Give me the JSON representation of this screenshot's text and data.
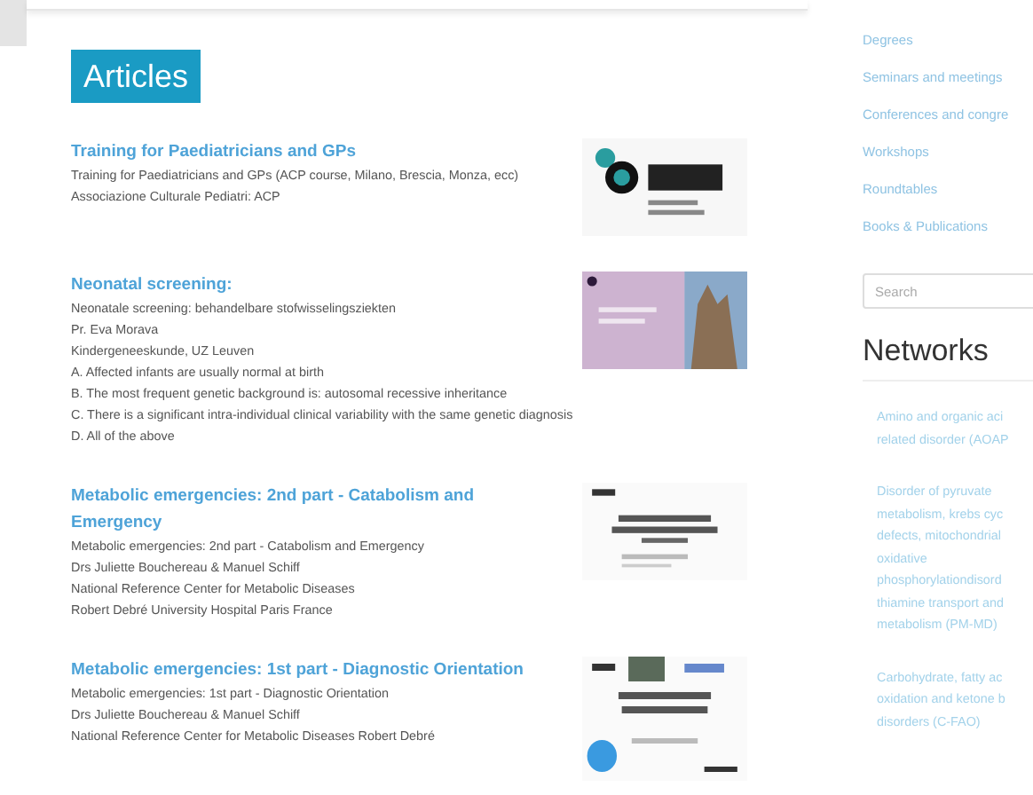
{
  "header": {
    "title": "Articles"
  },
  "articles": [
    {
      "title": "Training for Paediatricians and GPs",
      "lines": [
        "Training for Paediatricians and GPs (ACP course, Milano, Brescia, Monza, ecc)",
        "Associazione Culturale Pediatri: ACP"
      ],
      "thumbnail": {
        "kind": "picture"
      }
    },
    {
      "title": "Neonatal screening:",
      "lines": [
        "Neonatale screening: behandelbare stofwisselingsziekten",
        "Pr. Eva Morava",
        "Kindergeneeskunde, UZ Leuven",
        "A. Affected infants are usually normal at birth",
        "B. The most frequent genetic background is: autosomal recessive inheritance",
        "C. There is a significant intra-individual clinical variability with the same genetic diagnosis",
        "D. All of the above"
      ],
      "thumbnail": {
        "kind": "picture"
      }
    },
    {
      "title": "Metabolic emergencies: 2nd part - Catabolism and Emergency",
      "lines": [
        "Metabolic emergencies: 2nd part - Catabolism and Emergency",
        "Drs Juliette Bouchereau & Manuel Schiff",
        "National Reference Center for Metabolic Diseases",
        "Robert Debré University Hospital Paris France"
      ],
      "thumbnail": {
        "kind": "picture"
      }
    },
    {
      "title": "Metabolic emergencies: 1st part - Diagnostic Orientation",
      "lines": [
        "Metabolic emergencies: 1st part - Diagnostic Orientation",
        "Drs Juliette Bouchereau & Manuel Schiff",
        "National Reference Center for Metabolic Diseases Robert Debré"
      ],
      "thumbnail": {
        "kind": "picture"
      }
    }
  ],
  "sidebar": {
    "links": [
      "Degrees",
      "Seminars and meetings",
      "Conferences and congre",
      "Workshops",
      "Roundtables",
      "Books & Publications"
    ],
    "search": {
      "placeholder": "Search"
    },
    "networks_title": "Networks",
    "networks": [
      {
        "lines": [
          "Amino and organic aci",
          "related disorder (AOAP"
        ]
      },
      {
        "lines": [
          "Disorder of pyruvate",
          "metabolism, krebs cyc",
          "defects, mitochondrial",
          "oxidative",
          "phosphorylationdisord",
          "thiamine transport and",
          "metabolism (PM-MD)"
        ]
      },
      {
        "lines": [
          "Carbohydrate, fatty ac",
          "oxidation and ketone b",
          "disorders (C-FAO)"
        ]
      }
    ]
  }
}
